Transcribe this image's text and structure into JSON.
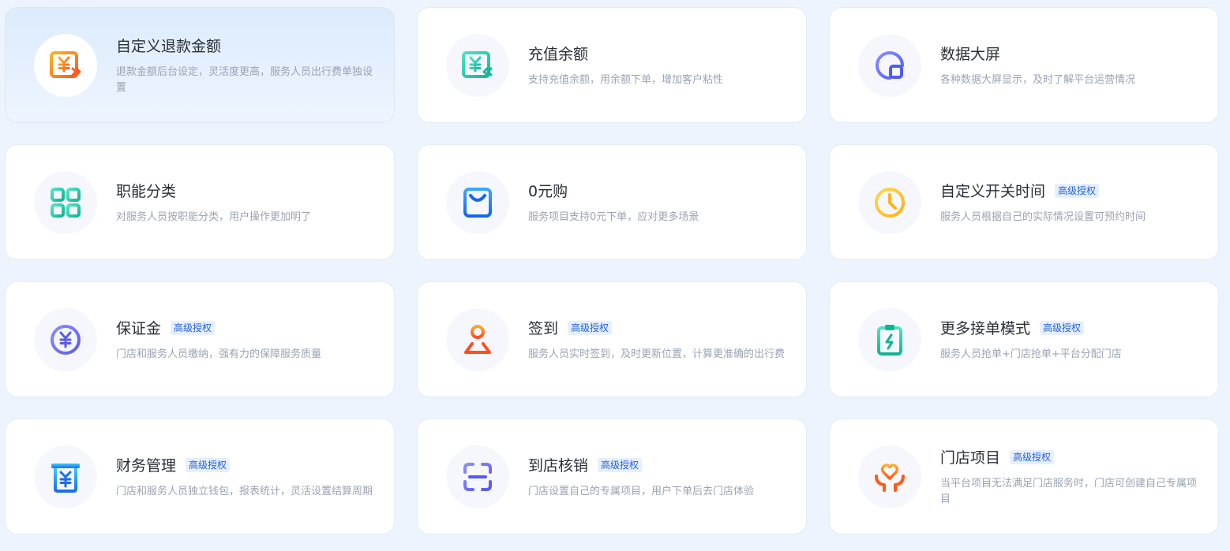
{
  "badge_label": "高级授权",
  "cards": [
    {
      "title": "自定义退款金额",
      "desc": "退款金额后台设定，灵活度更高，服务人员出行费单独设置",
      "icon": "refund-yuan-icon",
      "has_badge": false,
      "active": true
    },
    {
      "title": "充值余额",
      "desc": "支持充值余额，用余额下单，增加客户粘性",
      "icon": "recharge-yuan-icon",
      "has_badge": false
    },
    {
      "title": "数据大屏",
      "desc": "各种数据大屏显示，及时了解平台运营情况",
      "icon": "data-screen-icon",
      "has_badge": false
    },
    {
      "title": "职能分类",
      "desc": "对服务人员按职能分类，用户操作更加明了",
      "icon": "grid-category-icon",
      "has_badge": false
    },
    {
      "title": "0元购",
      "desc": "服务项目支持0元下单，应对更多场景",
      "icon": "shopping-bag-icon",
      "has_badge": false
    },
    {
      "title": "自定义开关时间",
      "desc": "服务人员根据自己的实际情况设置可预约时间",
      "icon": "clock-icon",
      "has_badge": true
    },
    {
      "title": "保证金",
      "desc": "门店和服务人员缴纳，强有力的保障服务质量",
      "icon": "deposit-yuan-icon",
      "has_badge": true
    },
    {
      "title": "签到",
      "desc": "服务人员实时签到，及时更新位置，计算更准确的出行费",
      "icon": "location-pin-icon",
      "has_badge": true
    },
    {
      "title": "更多接单模式",
      "desc": "服务人员抢单+门店抢单+平台分配门店",
      "icon": "clipboard-lightning-icon",
      "has_badge": true
    },
    {
      "title": "财务管理",
      "desc": "门店和服务人员独立钱包，报表统计，灵活设置结算周期",
      "icon": "finance-yuan-icon",
      "has_badge": true
    },
    {
      "title": "到店核销",
      "desc": "门店设置自己的专属项目，用户下单后去门店体验",
      "icon": "scan-verify-icon",
      "has_badge": true
    },
    {
      "title": "门店项目",
      "desc": "当平台项目无法满足门店服务时，门店可创建自己专属项目",
      "icon": "heart-hands-icon",
      "has_badge": true
    }
  ]
}
